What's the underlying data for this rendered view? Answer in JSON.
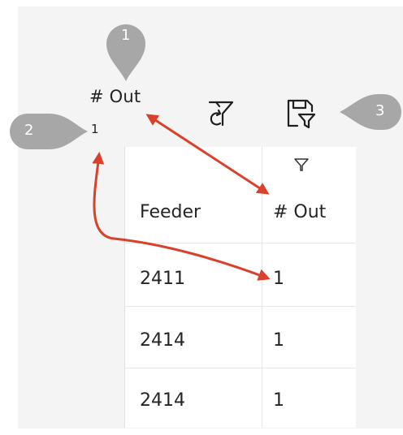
{
  "callouts": [
    {
      "number": "1"
    },
    {
      "number": "2"
    },
    {
      "number": "3"
    }
  ],
  "card": {
    "title": "# Out",
    "value": "1"
  },
  "toolbar": {
    "icons": [
      "clear-filter-icon",
      "save-filter-icon"
    ]
  },
  "table": {
    "header_filter_icon": "filter-icon",
    "columns": [
      "Feeder",
      "# Out"
    ],
    "rows": [
      [
        "2411",
        "1"
      ],
      [
        "2414",
        "1"
      ],
      [
        "2414",
        "1"
      ]
    ]
  },
  "colors": {
    "callout_fill": "#a7a7a7",
    "arrow": "#d9412b",
    "panel_bg": "#f4f4f4"
  }
}
